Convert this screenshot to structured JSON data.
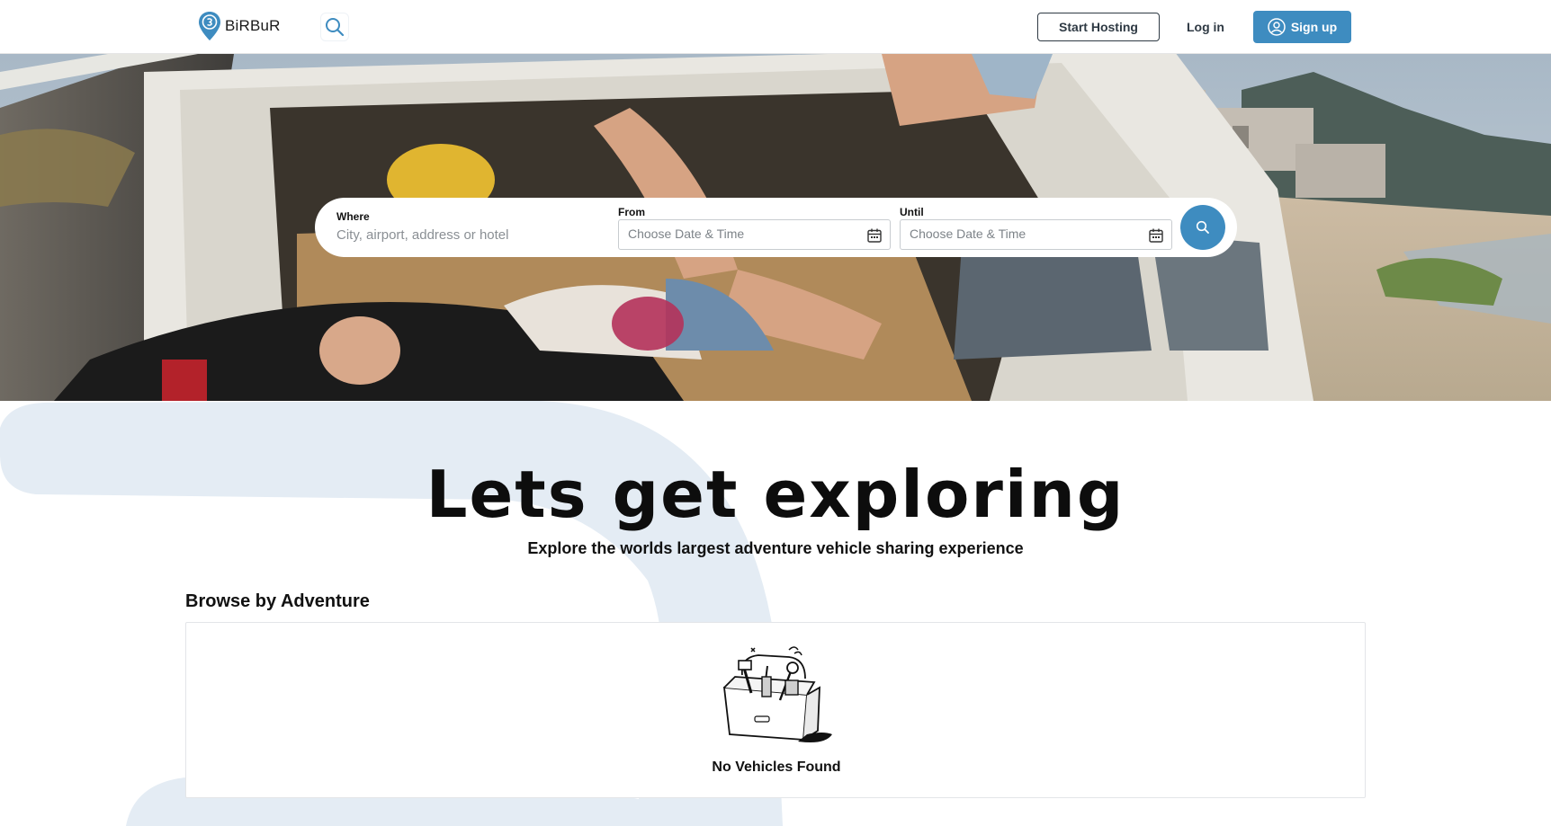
{
  "header": {
    "brand_name": "BiRBuR",
    "start_hosting_label": "Start Hosting",
    "login_label": "Log in",
    "signup_label": "Sign up"
  },
  "search": {
    "where_label": "Where",
    "where_placeholder": "City, airport, address or hotel",
    "from_label": "From",
    "from_placeholder": "Choose Date & Time",
    "until_label": "Until",
    "until_placeholder": "Choose Date & Time"
  },
  "main": {
    "title": "Lets get exploring",
    "subtitle": "Explore the worlds largest adventure vehicle sharing experience",
    "browse_title": "Browse by Adventure",
    "empty_message": "No Vehicles Found"
  },
  "colors": {
    "accent": "#3e8cc0",
    "blob": "#e4ecf4"
  }
}
